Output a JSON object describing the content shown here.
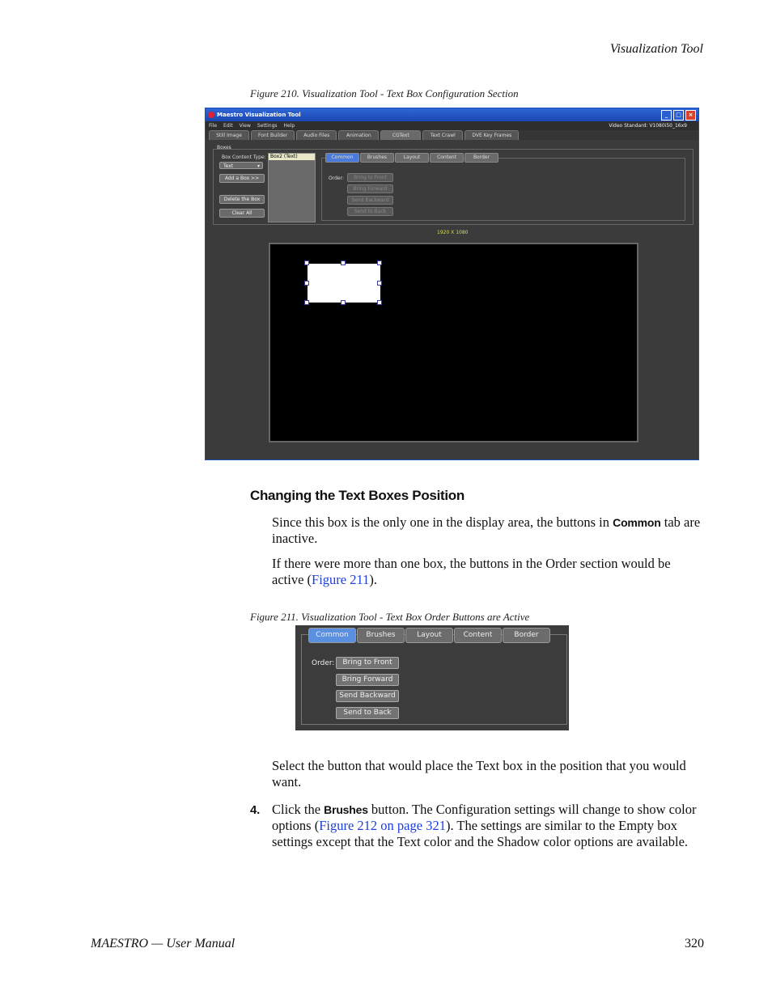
{
  "header": {
    "section_title": "Visualization Tool"
  },
  "figure210": {
    "caption": "Figure 210.  Visualization Tool - Text Box Configuration Section",
    "window_title": "Maestro Visualization Tool",
    "menu": [
      "File",
      "Edit",
      "View",
      "Settings",
      "Help"
    ],
    "video_standard": "Video Standard: V1080i50_16x9",
    "tabs": [
      "Still Image",
      "Font Builder",
      "Audio Files",
      "Animation",
      "CGText",
      "Text Crawl",
      "DVE Key Frames"
    ],
    "active_tab": "CGText",
    "boxes_group": "Boxes",
    "box_content_type_label": "Box Content Type:",
    "box_content_type_value": "Text",
    "add_box": "Add a Box >>",
    "delete_box": "Delete the Box",
    "clear_all": "Clear All",
    "list_selected": "Box2 (Text)",
    "inner_tabs": [
      "Common",
      "Brushes",
      "Layout",
      "Content",
      "Border"
    ],
    "order_label": "Order:",
    "order_buttons": [
      "Bring to Front",
      "Bring Forward",
      "Send Backward",
      "Send to Back"
    ],
    "resolution": "1920 X 1080"
  },
  "section": {
    "heading": "Changing the Text Boxes Position",
    "p1_before": "Since this box is the only one in the display area, the buttons in ",
    "p1_kw": "Common",
    "p1_after": " tab are inactive.",
    "p2_before": "If there were more than one box, the buttons in the Order section would be active (",
    "p2_link": "Figure 211",
    "p2_after": ")."
  },
  "figure211": {
    "caption": "Figure 211.  Visualization Tool - Text Box Order Buttons are Active",
    "tabs": [
      "Common",
      "Brushes",
      "Layout",
      "Content",
      "Border"
    ],
    "order_label": "Order:",
    "buttons": [
      "Bring to Front",
      "Bring Forward",
      "Send Backward",
      "Send to Back"
    ]
  },
  "after": {
    "p3": "Select the button that would place the Text box in the position that you would want.",
    "step_num": "4.",
    "step_before": "Click the ",
    "step_kw": "Brushes",
    "step_mid": " button. The Configuration settings will change to show color options (",
    "step_link": "Figure 212 on page 321",
    "step_after": "). The settings are similar to the Empty box settings except that the Text color and the Shadow color options are available."
  },
  "footer": {
    "left": "MAESTRO  —  User Manual",
    "page": "320"
  }
}
